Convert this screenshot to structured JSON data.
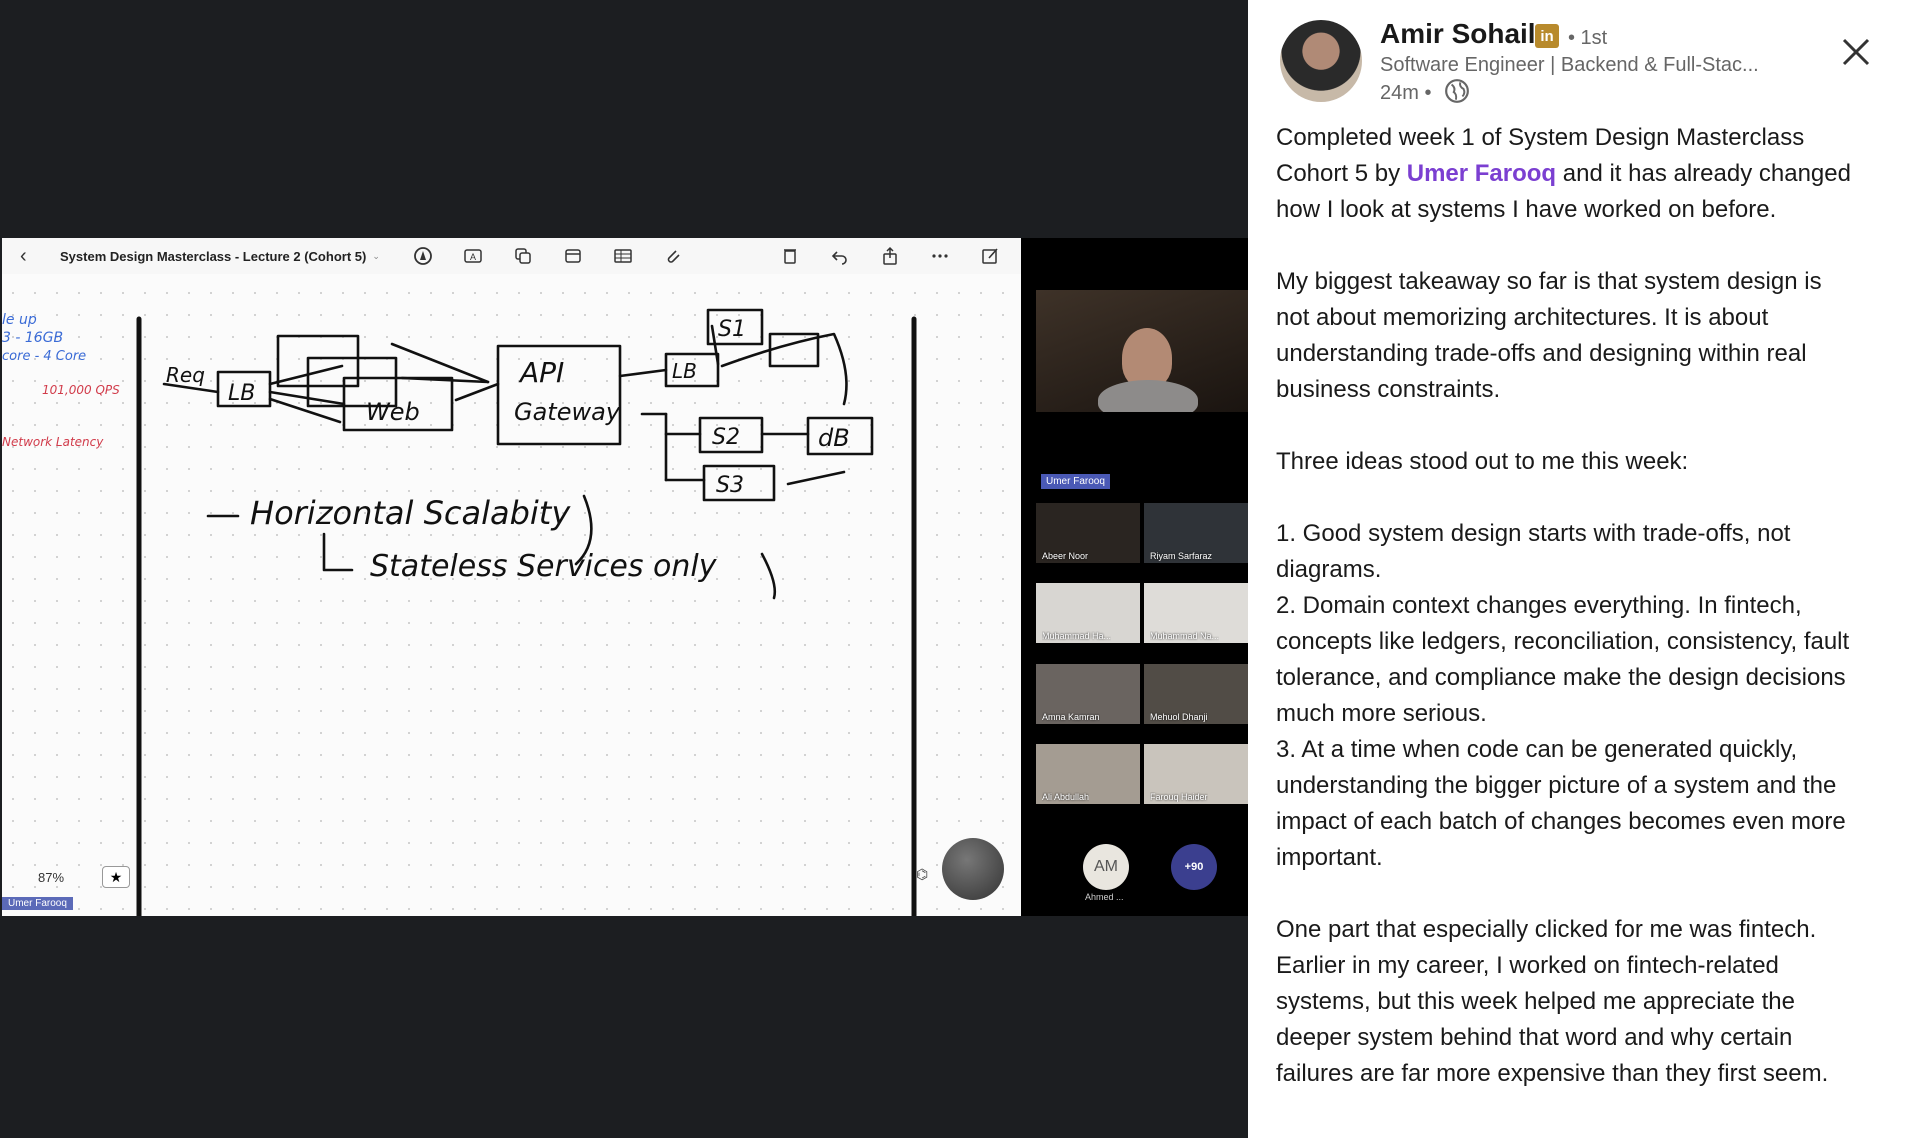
{
  "board": {
    "title": "System Design Masterclass - Lecture 2 (Cohort 5)",
    "zoom": "87%",
    "presenter_label": "Umer Farooq",
    "toolbar_icons": [
      "back-icon",
      "pen-circle-icon",
      "text-box-icon",
      "shapes-icon",
      "sticky-note-icon",
      "table-icon",
      "paperclip-icon",
      "delete-icon",
      "undo-icon",
      "share-icon",
      "more-icon",
      "edit-icon"
    ],
    "sketch": {
      "req": "Req",
      "lb": "LB",
      "web": "Web",
      "api": "API",
      "gateway": "Gateway",
      "lb2": "LB",
      "s1": "S1",
      "s2": "S2",
      "s3": "S3",
      "db": "dB",
      "line1": "Horizontal Scalabity",
      "line2": "Stateless Services only",
      "side_notes": [
        "le up",
        "3 - 16GB",
        "core - 4 Core",
        "101,000 QPS",
        "Network Latency"
      ]
    }
  },
  "participants": {
    "host": "Umer Farooq",
    "tiles": [
      "Abeer Noor",
      "Riyam Sarfaraz",
      "Muhammad Ha...",
      "Muhammad Na...",
      "Amna Kamran",
      "Mehuol Dhanji",
      "Ali Abdullah",
      "Farouq Haider"
    ],
    "avatar_initials": "AM",
    "avatar_name": "Ahmed ...",
    "more_count": "+90"
  },
  "post": {
    "author": "Amir Sohail",
    "badge": "in",
    "degree": "• 1st",
    "headline": "Software Engineer | Backend & Full-Stac...",
    "time": "24m •",
    "body_lines": {
      "p1": [
        "Completed week 1 of System Design Masterclass"
      ],
      "p1_l2_pre": "Cohort 5 by ",
      "mention": "Umer Farooq",
      "p1_l2_post": " and it has already changed",
      "p1_l3": "how I look at systems I have worked on before.",
      "p2": [
        "My biggest takeaway so far is that system design is",
        "not about memorizing architectures. It is about",
        "understanding trade-offs and designing within real",
        "business constraints."
      ],
      "p3": [
        "Three ideas stood out to me this week:"
      ],
      "p4": [
        "1. Good system design starts with trade-offs, not",
        "diagrams.",
        "2. Domain context changes everything. In fintech,",
        "concepts like ledgers, reconciliation, consistency, fault",
        "tolerance, and compliance make the design decisions",
        "much more serious.",
        "3. At a time when code can be generated quickly,",
        "understanding the bigger picture of a system and the",
        "impact of each batch of changes becomes even more",
        "important."
      ],
      "p5": [
        "One part that especially clicked for me was fintech.",
        "Earlier in my career, I worked on fintech-related",
        "systems, but this week helped me appreciate the",
        "deeper system behind that word and why certain",
        "failures are far more expensive than they first seem."
      ]
    }
  }
}
